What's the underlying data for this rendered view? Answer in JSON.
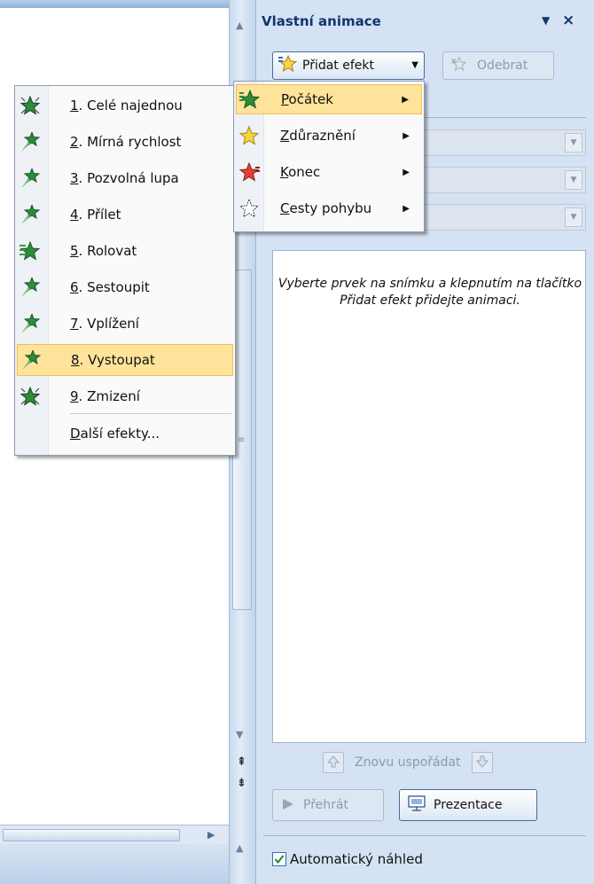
{
  "pane": {
    "title": "Vlastní animace",
    "dropdown_glyph": "▼",
    "close_glyph": "×",
    "add_effect_label": "Přidat efekt",
    "remove_label": "Odebrat",
    "hint": "Vyberte prvek na snímku a klepnutím na tlačítko Přidat efekt přidejte animaci.",
    "reorder_label": "Znovu uspořádat",
    "play_label": "Přehrát",
    "slideshow_label": "Prezentace",
    "auto_preview_label": "Automatický náhled",
    "auto_preview_checked": true
  },
  "effect_types_menu": {
    "items": [
      {
        "key": "P",
        "rest": "očátek",
        "icon": "entrance-star-icon",
        "highlighted": true,
        "has_submenu": true
      },
      {
        "key": "Z",
        "rest": "důraznění",
        "icon": "emphasis-star-icon",
        "highlighted": false,
        "has_submenu": true
      },
      {
        "key": "K",
        "rest": "onec",
        "icon": "exit-star-icon",
        "highlighted": false,
        "has_submenu": true
      },
      {
        "key": "C",
        "rest": "esty pohybu",
        "icon": "motion-path-star-icon",
        "highlighted": false,
        "has_submenu": true
      }
    ]
  },
  "entrance_effects_menu": {
    "items": [
      {
        "key": "1",
        "rest": ". Celé najednou",
        "icon": "appear-icon"
      },
      {
        "key": "2",
        "rest": ". Mírná rychlost",
        "icon": "fly-star-icon"
      },
      {
        "key": "3",
        "rest": ". Pozvolná lupa",
        "icon": "fly-star-icon"
      },
      {
        "key": "4",
        "rest": ". Přílet",
        "icon": "fly-star-icon"
      },
      {
        "key": "5",
        "rest": ". Rolovat",
        "icon": "wipe-star-icon"
      },
      {
        "key": "6",
        "rest": ". Sestoupit",
        "icon": "fly-star-icon"
      },
      {
        "key": "7",
        "rest": ". Vplížení",
        "icon": "fly-star-icon"
      },
      {
        "key": "8",
        "rest": ". Vystoupat",
        "icon": "fly-star-icon",
        "highlighted": true
      },
      {
        "key": "9",
        "rest": ". Zmizení",
        "icon": "appear-icon"
      }
    ],
    "more": {
      "key": "D",
      "rest": "alší efekty..."
    }
  },
  "colors": {
    "pane_bg": "#d4e2f4",
    "title_color": "#13356c",
    "highlight": "#ffe39a",
    "entrance_green": "#2e8b3a"
  }
}
